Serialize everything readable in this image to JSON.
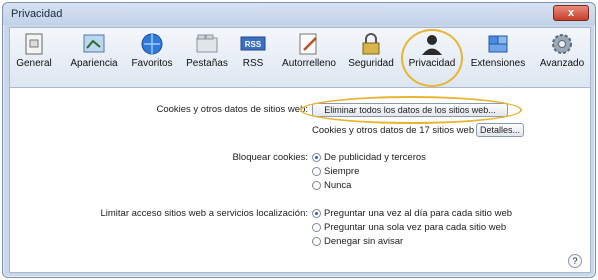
{
  "window": {
    "title": "Privacidad",
    "close_label": "x"
  },
  "toolbar": {
    "items": [
      {
        "label": "General",
        "icon": "general-icon"
      },
      {
        "label": "Apariencia",
        "icon": "appearance-icon"
      },
      {
        "label": "Favoritos",
        "icon": "globe-icon"
      },
      {
        "label": "Pestañas",
        "icon": "tabs-icon"
      },
      {
        "label": "RSS",
        "icon": "rss-icon",
        "icon_text": "RSS"
      },
      {
        "label": "Autorrelleno",
        "icon": "pencil-icon"
      },
      {
        "label": "Seguridad",
        "icon": "lock-icon"
      },
      {
        "label": "Privacidad",
        "icon": "person-silhouette-icon",
        "selected": true
      },
      {
        "label": "Extensiones",
        "icon": "puzzle-icon"
      },
      {
        "label": "Avanzado",
        "icon": "gear-icon"
      }
    ]
  },
  "cookies": {
    "label": "Cookies y otros datos de sitios web:",
    "remove_all_button": "Eliminar todos los datos de los sitios web...",
    "sites_info": "Cookies y otros datos de 17 sitios web",
    "details_button": "Detalles..."
  },
  "block_cookies": {
    "label": "Bloquear cookies:",
    "options": [
      "De publicidad y terceros",
      "Siempre",
      "Nunca"
    ],
    "selected_index": 0
  },
  "location": {
    "label": "Limitar acceso sitios web a servicios localización:",
    "options": [
      "Preguntar una vez al día para cada sitio web",
      "Preguntar una sola vez para cada sitio web",
      "Denegar sin avisar"
    ],
    "selected_index": 0
  },
  "help_label": "?",
  "colors": {
    "highlight": "#e8b432",
    "accent": "#2a63b8"
  }
}
